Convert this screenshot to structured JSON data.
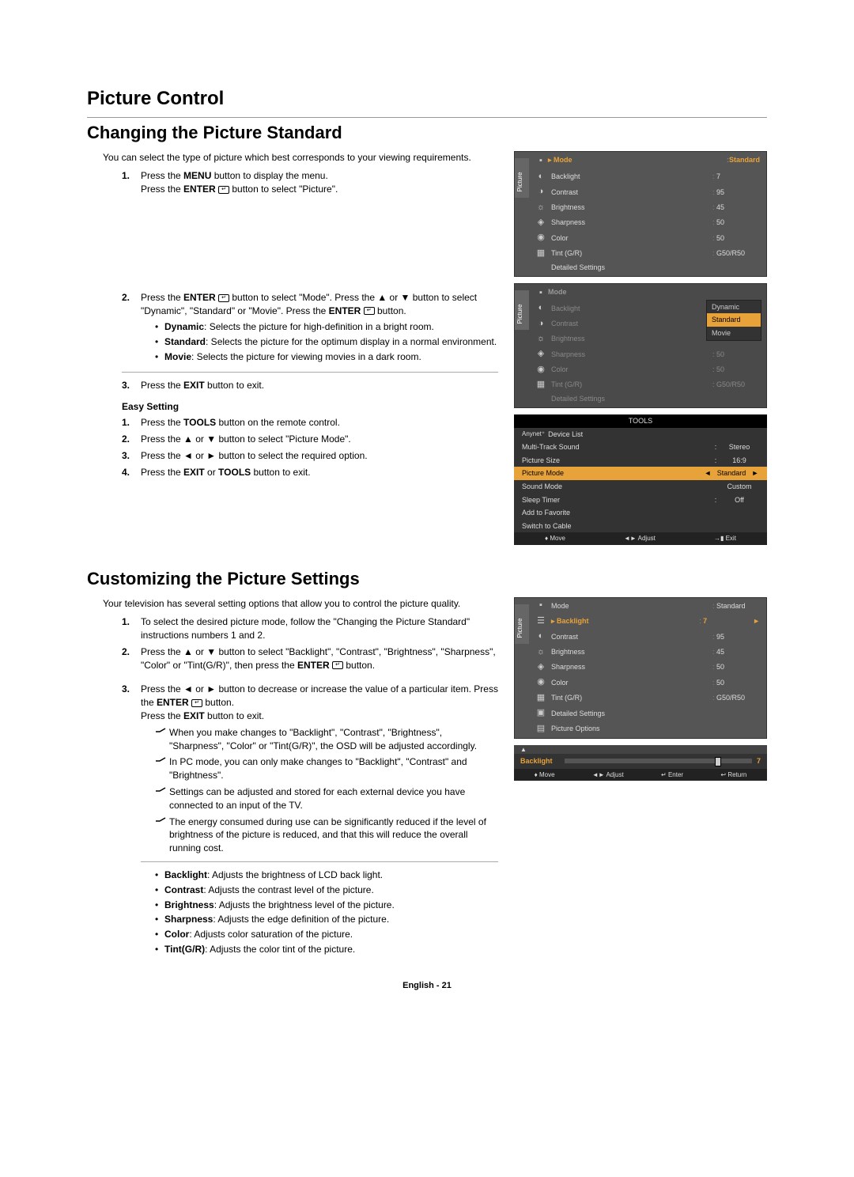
{
  "title": "Picture Control",
  "section1": {
    "heading": "Changing the Picture Standard",
    "intro": "You can select the type of picture which best corresponds to your viewing requirements.",
    "steps": [
      "1.",
      "2.",
      "3."
    ],
    "step1a": "Press the ",
    "step1b": "MENU",
    "step1c": " button to display the menu.",
    "step1d": "Press the ",
    "step1e": "ENTER",
    "step1f": " button to select \"Picture\".",
    "step2a": "Press the ",
    "step2b": "ENTER",
    "step2c": " button to select \"Mode\". Press the ▲ or ▼ button to select \"Dynamic\", \"Standard\" or \"Movie\". Press the ",
    "step2d": "ENTER",
    "step2e": " button.",
    "b1a": "Dynamic",
    "b1b": ": Selects the picture for high-definition in a bright room.",
    "b2a": "Standard",
    "b2b": ": Selects the picture for the optimum display in a normal environment.",
    "b3a": "Movie",
    "b3b": ": Selects the picture for viewing movies in a dark room.",
    "step3a": "Press the ",
    "step3b": "EXIT",
    "step3c": " button to exit.",
    "easy": "Easy Setting",
    "e1a": "Press the ",
    "e1b": "TOOLS",
    "e1c": " button on the remote control.",
    "e2": "Press the ▲ or ▼ button to select \"Picture Mode\".",
    "e3": "Press the ◄ or ► button to select the required option.",
    "e4a": "Press the ",
    "e4b": "EXIT",
    "e4c": " or ",
    "e4d": "TOOLS",
    "e4e": " button to exit."
  },
  "section2": {
    "heading": "Customizing the Picture Settings",
    "intro": "Your television has several setting options that allow you to control the picture quality.",
    "steps": [
      "1.",
      "2.",
      "3."
    ],
    "s1": "To select the desired picture mode, follow the \"Changing the Picture Standard\" instructions numbers 1 and 2.",
    "s2a": "Press the ▲ or ▼ button to select \"Backlight\", \"Contrast\", \"Brightness\", \"Sharpness\", \"Color\" or \"Tint(G/R)\", then press the ",
    "s2b": "ENTER",
    "s2c": " button.",
    "s3a": "Press the ◄ or ► button to decrease or increase the value of a particular item. Press the ",
    "s3b": "ENTER",
    "s3c": " button.",
    "s3d": "Press the ",
    "s3e": "EXIT",
    "s3f": " button to exit.",
    "n1": "When you make changes to \"Backlight\", \"Contrast\", \"Brightness\", \"Sharpness\", \"Color\" or \"Tint(G/R)\", the OSD will be adjusted accordingly.",
    "n2": "In PC mode, you can only make changes to \"Backlight\", \"Contrast\" and \"Brightness\".",
    "n3": "Settings can be adjusted and stored for each external device you have connected to an input of the TV.",
    "n4": "The energy consumed during use can be significantly reduced if the level of brightness of the picture is reduced, and that this will reduce the overall running cost.",
    "d1a": "Backlight",
    "d1b": ": Adjusts the brightness of LCD back light.",
    "d2a": "Contrast",
    "d2b": ": Adjusts the contrast level of the picture.",
    "d3a": "Brightness",
    "d3b": ": Adjusts the brightness level of the picture.",
    "d4a": "Sharpness",
    "d4b": ": Adjusts the edge definition of the picture.",
    "d5a": "Color",
    "d5b": ": Adjusts color saturation of the picture.",
    "d6a": "Tint(G/R)",
    "d6b": ": Adjusts the color tint of the picture."
  },
  "osd": {
    "picture": "Picture",
    "mode": "Mode",
    "modeVal": "Standard",
    "backlight": "Backlight",
    "backlightVal": "7",
    "contrast": "Contrast",
    "contrastVal": "95",
    "brightness": "Brightness",
    "brightnessVal": "45",
    "sharpness": "Sharpness",
    "sharpnessVal": "50",
    "color": "Color",
    "colorVal": "50",
    "tint": "Tint (G/R)",
    "tintVal": "G50/R50",
    "detailed": "Detailed Settings",
    "picsize": "Picture Size",
    "picsizeVal": "16:9",
    "picopt": "Picture Options",
    "popup": {
      "dynamic": "Dynamic",
      "standard": "Standard",
      "movie": "Movie"
    }
  },
  "tools": {
    "title": "TOOLS",
    "device": "Device List",
    "mts": "Multi-Track Sound",
    "mtsVal": "Stereo",
    "psize": "Picture Size",
    "psizeVal": "16:9",
    "pmode": "Picture Mode",
    "pmodeVal": "Standard",
    "smode": "Sound Mode",
    "smodeVal": "Custom",
    "sleep": "Sleep Timer",
    "sleepVal": "Off",
    "fav": "Add to Favorite",
    "cable": "Switch to Cable",
    "move": "Move",
    "adjust": "Adjust",
    "exit": "Exit",
    "enter": "Enter",
    "return": "Return"
  },
  "slider": {
    "label": "Backlight",
    "arrow": "▲",
    "val": "7"
  },
  "footer": "English - 21",
  "colon": ":"
}
